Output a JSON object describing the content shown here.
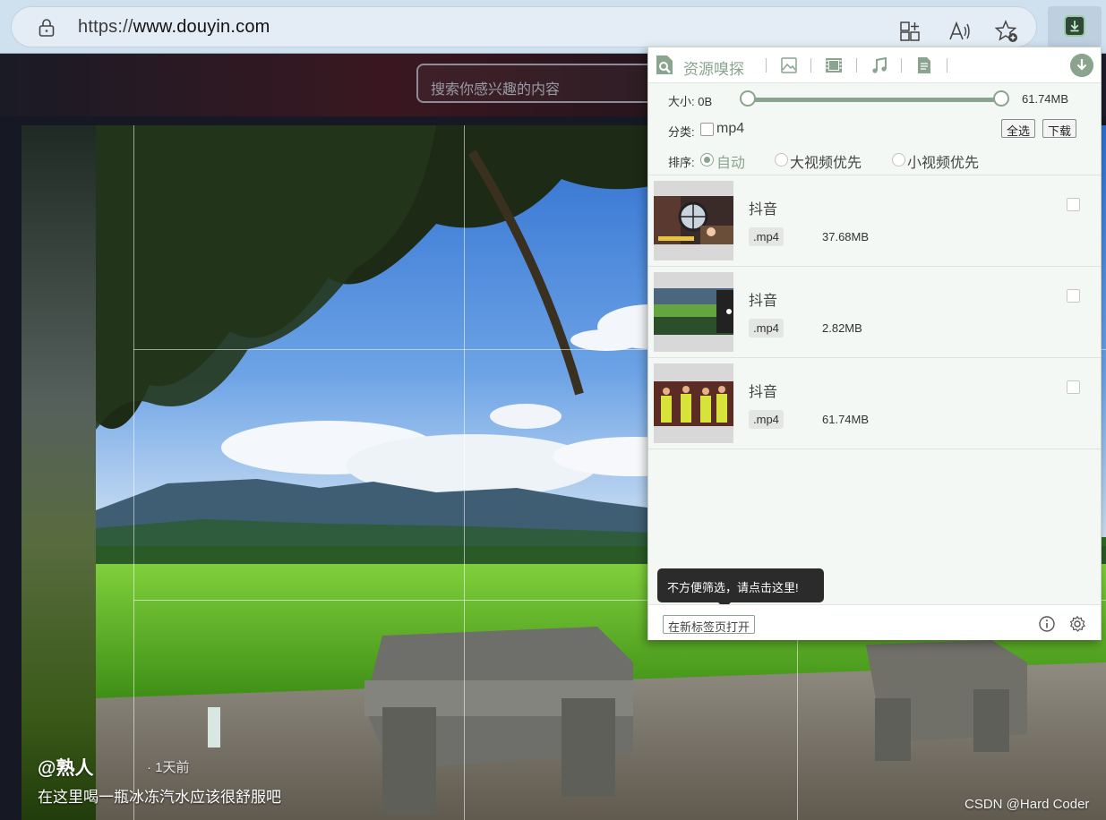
{
  "browser": {
    "url_prefix": "https://",
    "url_domain": "www.douyin.com",
    "toolbar_icons": [
      "lock-icon",
      "split-screen-icon",
      "read-aloud-icon",
      "add-favorite-icon",
      "extension-download-icon"
    ]
  },
  "site": {
    "search_placeholder": "搜索你感兴趣的内容",
    "video": {
      "author": "@熟人",
      "time": "· 1天前",
      "description": "在这里喝一瓶冰冻汽水应该很舒服吧"
    },
    "watermark": "CSDN @Hard Coder"
  },
  "popup": {
    "title": "资源嗅探",
    "tabs": [
      "image-icon",
      "video-icon",
      "music-icon",
      "document-icon"
    ],
    "size_label": "大小:",
    "size_min": "0B",
    "size_max": "61.74MB",
    "category_label": "分类:",
    "category_option": "mp4",
    "select_all": "全选",
    "download": "下载",
    "sort_label": "排序:",
    "sort_options": [
      {
        "label": "自动",
        "selected": true
      },
      {
        "label": "大视频优先",
        "selected": false
      },
      {
        "label": "小视频优先",
        "selected": false
      }
    ],
    "items": [
      {
        "title": "抖音",
        "ext": ".mp4",
        "size": "37.68MB"
      },
      {
        "title": "抖音",
        "ext": ".mp4",
        "size": "2.82MB"
      },
      {
        "title": "抖音",
        "ext": ".mp4",
        "size": "61.74MB"
      }
    ],
    "tooltip": "不方便筛选，请点击这里!",
    "open_in_tab": "在新标签页打开",
    "accent_color": "#8aa48f"
  }
}
